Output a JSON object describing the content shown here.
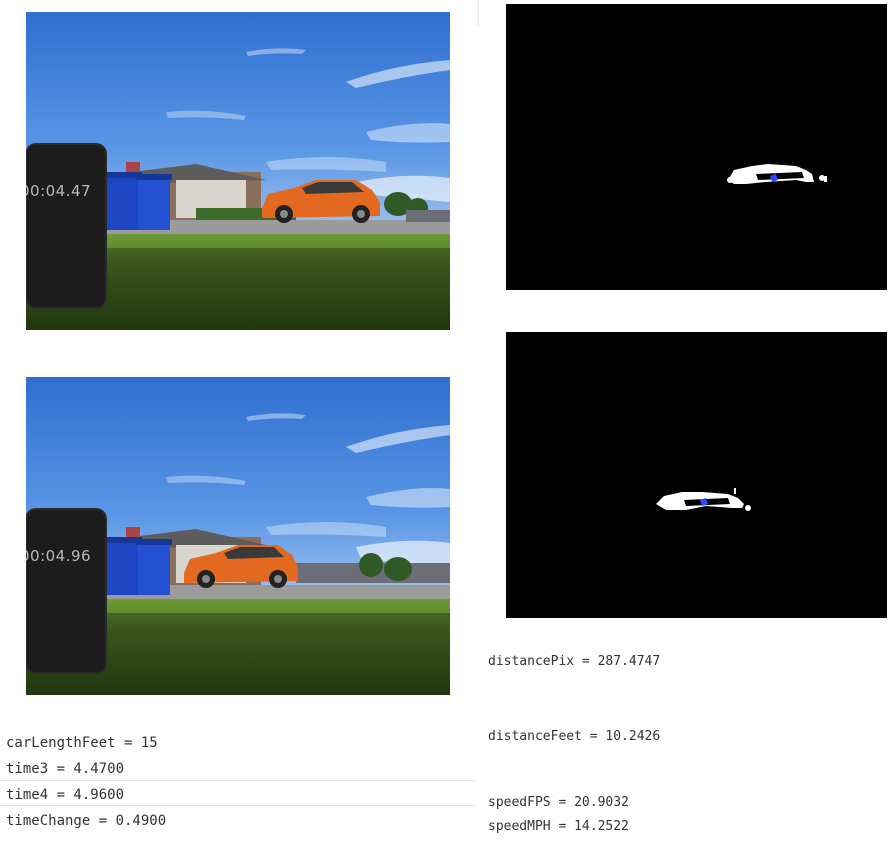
{
  "photos": [
    {
      "stopwatch": "00:04.47"
    },
    {
      "stopwatch": "00:04.96"
    }
  ],
  "colors": {
    "sky": "#3f7fd6",
    "car": "#e2691f",
    "bin": "#1e46c4",
    "grass": "#5f8a2c",
    "centroid": "#2a4bff"
  },
  "left_output": {
    "car_length": "carLengthFeet = 15",
    "time3": "time3 = 4.4700",
    "time4": "time4 = 4.9600",
    "time_change": "timeChange = 0.4900"
  },
  "right_output": {
    "distance_pix": "distancePix = 287.4747",
    "distance_feet": "distanceFeet = 10.2426",
    "speed_fps": "speedFPS = 20.9032",
    "speed_mph": "speedMPH = 14.2522"
  }
}
